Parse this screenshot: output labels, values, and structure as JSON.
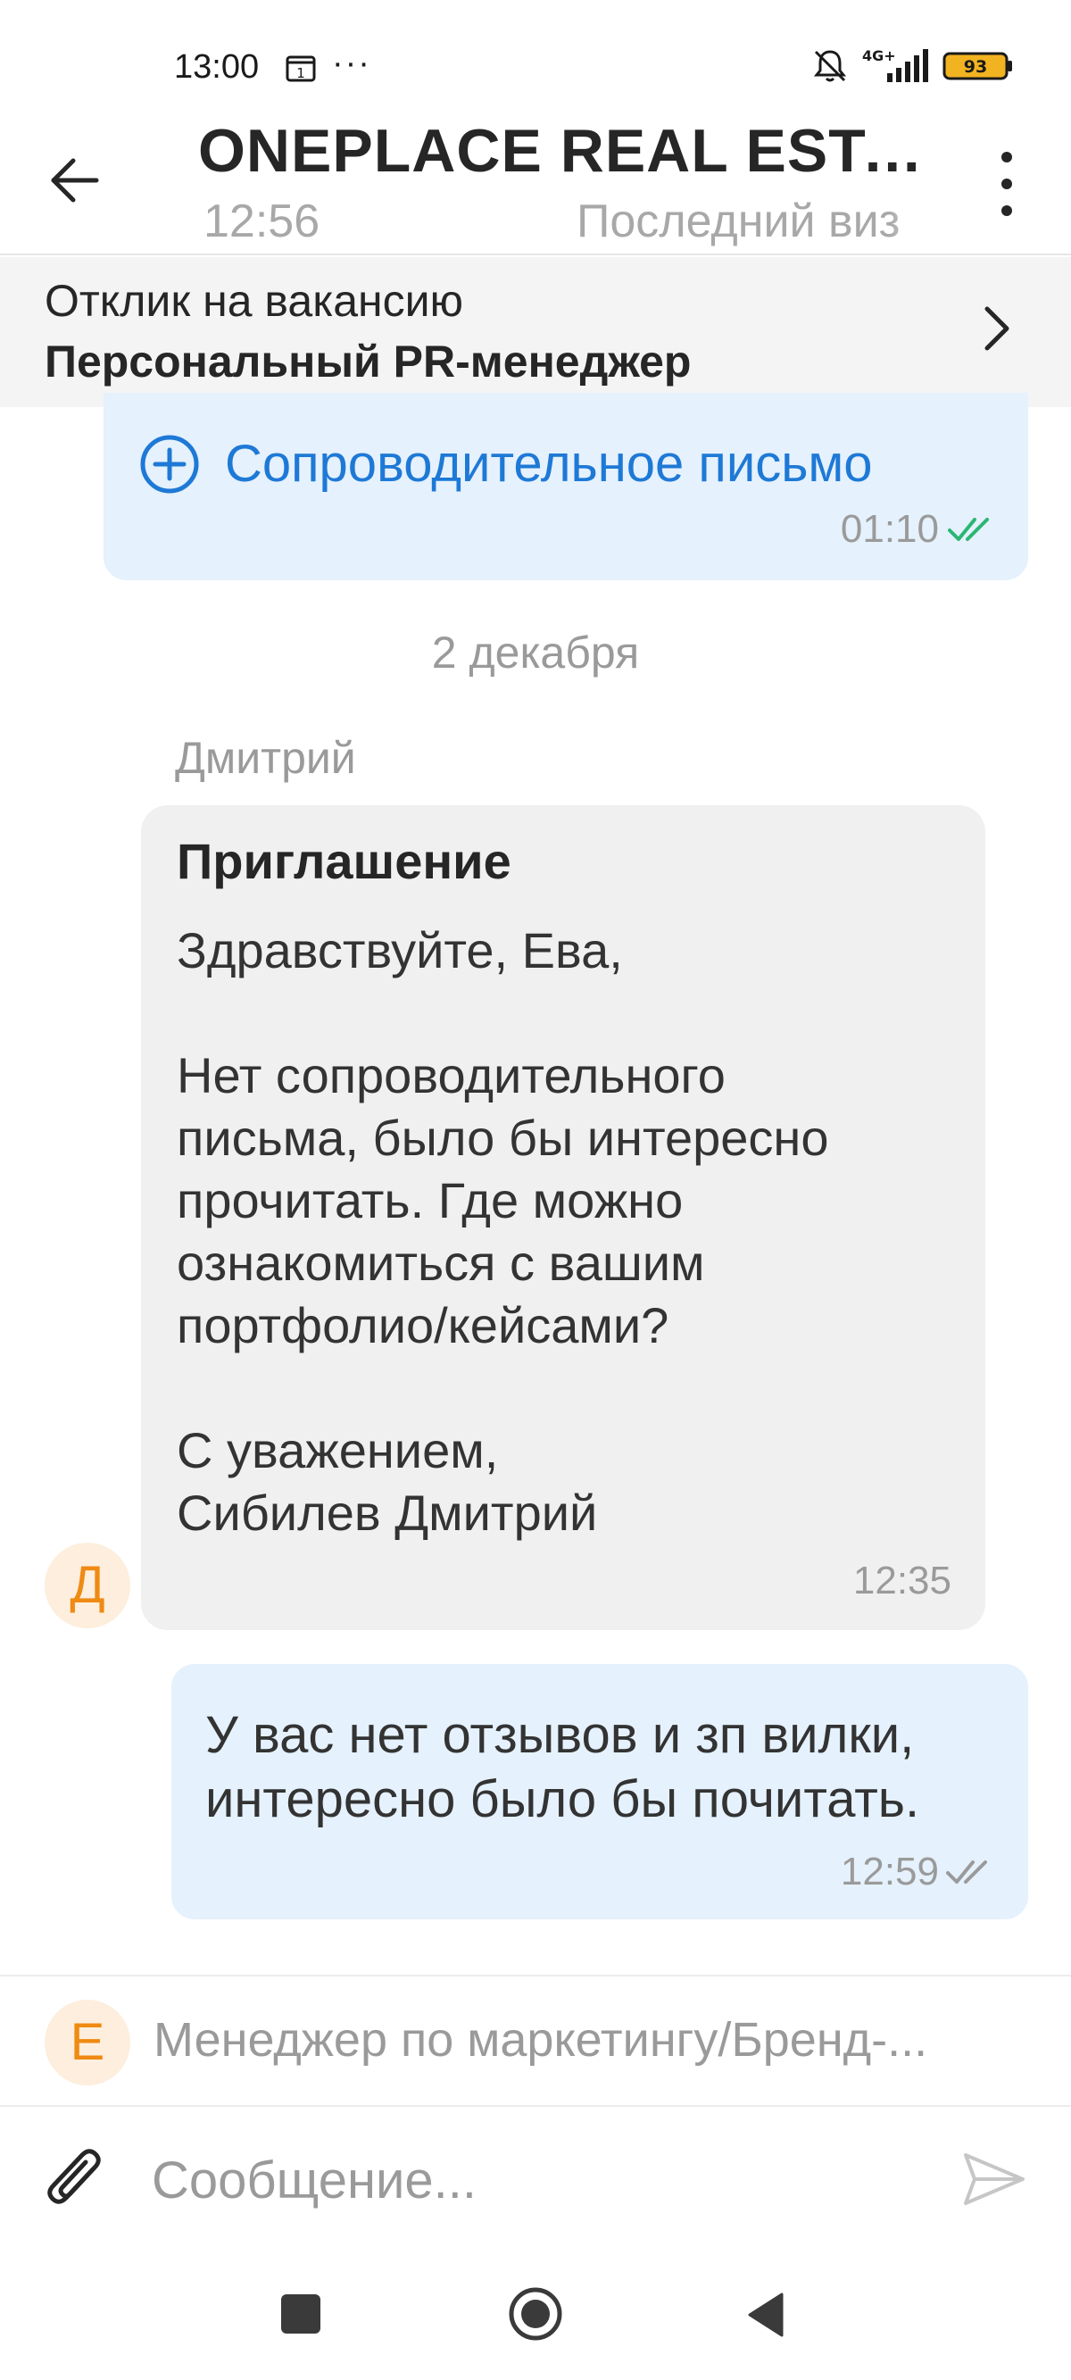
{
  "status_bar": {
    "time": "13:00",
    "calendar_day": "1",
    "more_indicator": "···",
    "network": "4G+",
    "battery": "93",
    "battery_color": "#f2b321"
  },
  "header": {
    "title": "ONEPLACE REAL ESTA...",
    "last_time": "12:56",
    "last_visit": "Последний виз"
  },
  "vacancy": {
    "caption": "Отклик на вакансию",
    "name": "Персональный PR-менеджер"
  },
  "chat": {
    "cover_letter": {
      "label": "Сопроводительное письмо",
      "time": "01:10",
      "status_color": "#2bb673"
    },
    "date_separator": "2 декабря",
    "incoming": {
      "sender": "Дмитрий",
      "avatar_letter": "Д",
      "title": "Приглашение",
      "text": "Здравствуйте, Ева,\n\nНет сопроводительного\nписьма, было бы интересно\nпрочитать. Где можно\nознакомиться с вашим\nпортфолио/кейсами?\n\nС уважением,\nСибилев Дмитрий",
      "time": "12:35"
    },
    "outgoing": {
      "text": "У вас нет отзывов и зп вилки,\nинтересно было бы почитать.",
      "time": "12:59"
    }
  },
  "composer": {
    "vacancy_avatar": "Е",
    "vacancy_text": "Менеджер по маркетингу/Бренд-...",
    "placeholder": "Сообщение..."
  },
  "colors": {
    "accent": "#1e79d6",
    "bubble_out": "#e5f1fc",
    "bubble_in": "#f0f0f0",
    "avatar_bg": "#fdeedd",
    "avatar_fg": "#ef8a12"
  }
}
